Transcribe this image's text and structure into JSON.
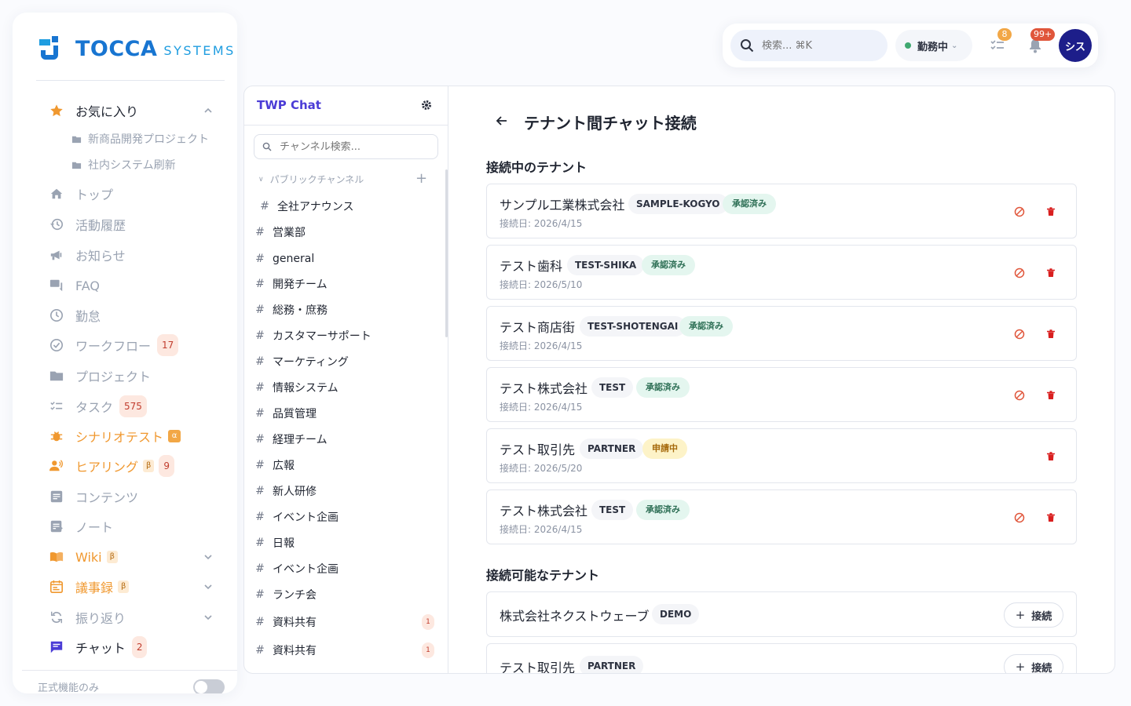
{
  "brand": {
    "name": "TOCCA",
    "sub": "SYSTEMS"
  },
  "colors": {
    "accent": "#4b3cd6",
    "brand": "#1875d1",
    "orange": "#f0982f",
    "danger": "#d91f1f",
    "avatar": "#1d1e8a"
  },
  "topbar": {
    "search_placeholder": "検索... ⌘K",
    "status_label": "勤務中",
    "tasks_badge": "8",
    "notifications_badge": "99+",
    "avatar_initials": "シス"
  },
  "sidebar": {
    "favorites": {
      "label": "お気に入り",
      "items": [
        "新商品開発プロジェクト",
        "社内システム刷新"
      ]
    },
    "items": [
      {
        "label": "トップ",
        "icon": "home-icon"
      },
      {
        "label": "活動履歴",
        "icon": "history-icon"
      },
      {
        "label": "お知らせ",
        "icon": "megaphone-icon"
      },
      {
        "label": "FAQ",
        "icon": "faq-icon"
      },
      {
        "label": "勤怠",
        "icon": "clock-icon"
      },
      {
        "label": "ワークフロー",
        "icon": "check-circle-icon",
        "count": "17"
      },
      {
        "label": "プロジェクト",
        "icon": "folder-icon"
      },
      {
        "label": "タスク",
        "icon": "checklist-icon",
        "count": "575"
      },
      {
        "label": "シナリオテスト",
        "icon": "bug-icon",
        "tag": "α"
      },
      {
        "label": "ヒアリング",
        "icon": "people-icon",
        "tag": "β",
        "count": "9"
      },
      {
        "label": "コンテンツ",
        "icon": "article-icon"
      },
      {
        "label": "ノート",
        "icon": "note-icon"
      },
      {
        "label": "Wiki",
        "icon": "book-icon",
        "tag": "β"
      },
      {
        "label": "議事録",
        "icon": "calendar-icon",
        "tag": "β"
      },
      {
        "label": "振り返り",
        "icon": "refresh-icon"
      },
      {
        "label": "チャット",
        "icon": "chat-icon",
        "count": "2"
      }
    ],
    "footer_label": "正式機能のみ"
  },
  "chat": {
    "title": "TWP Chat",
    "search_placeholder": "チャンネル検索...",
    "section_label": "パブリックチャンネル",
    "channels": [
      {
        "name": "全社アナウンス"
      },
      {
        "name": "営業部"
      },
      {
        "name": "general"
      },
      {
        "name": "開発チーム"
      },
      {
        "name": "総務・庶務"
      },
      {
        "name": "カスタマーサポート"
      },
      {
        "name": "マーケティング"
      },
      {
        "name": "情報システム"
      },
      {
        "name": "品質管理"
      },
      {
        "name": "経理チーム"
      },
      {
        "name": "広報"
      },
      {
        "name": "新人研修"
      },
      {
        "name": "イベント企画"
      },
      {
        "name": "日報"
      },
      {
        "name": "イベント企画"
      },
      {
        "name": "ランチ会"
      },
      {
        "name": "資料共有",
        "unread": "1"
      },
      {
        "name": "資料共有",
        "unread": "1"
      }
    ]
  },
  "main": {
    "title": "テナント間チャット接続",
    "connected_title": "接続中のテナント",
    "available_title": "接続可能なテナント",
    "connect_label": "接続",
    "connected": [
      {
        "name": "サンプル工業株式会社",
        "code": "SAMPLE-KOGYO",
        "status": "承認済み",
        "date": "接続日: 2026/4/15"
      },
      {
        "name": "テスト歯科",
        "code": "TEST-SHIKA",
        "status": "承認済み",
        "date": "接続日: 2026/5/10"
      },
      {
        "name": "テスト商店街",
        "code": "TEST-SHOTENGAI",
        "status": "承認済み",
        "date": "接続日: 2026/4/15"
      },
      {
        "name": "テスト株式会社",
        "code": "TEST",
        "status": "承認済み",
        "date": "接続日: 2026/4/15"
      },
      {
        "name": "テスト取引先",
        "code": "PARTNER",
        "status": "申請中",
        "date": "接続日: 2026/5/20"
      },
      {
        "name": "テスト株式会社",
        "code": "TEST",
        "status": "承認済み",
        "date": "接続日: 2026/4/15"
      }
    ],
    "available": [
      {
        "name": "株式会社ネクストウェーブ",
        "code": "DEMO"
      },
      {
        "name": "テスト取引先",
        "code": "PARTNER"
      }
    ]
  }
}
